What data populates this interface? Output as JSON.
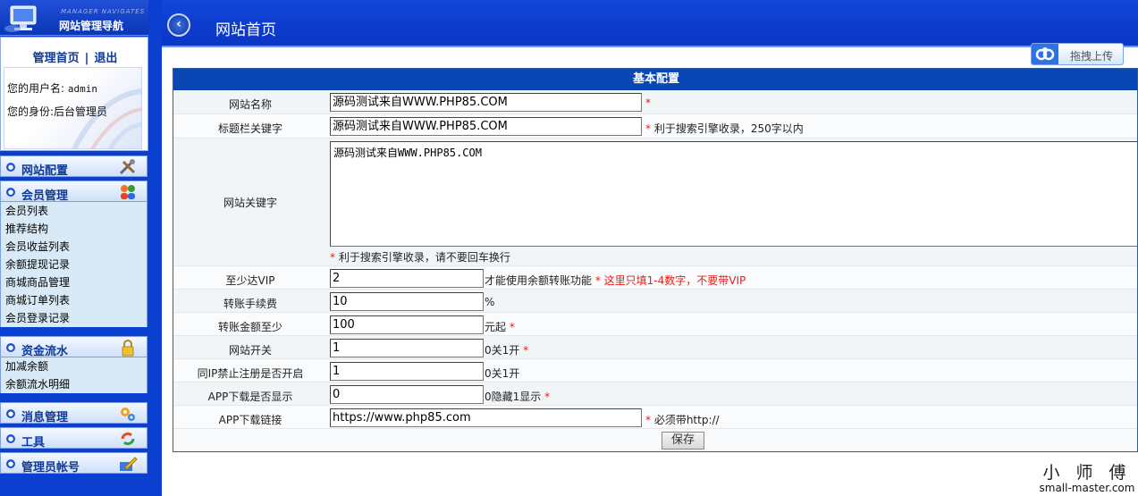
{
  "sidebar": {
    "logo_en": "MANAGER NAVIGATES",
    "logo_cn": "网站管理导航",
    "home_link": "管理首页",
    "separator": "|",
    "logout_link": "退出",
    "username_label": "您的用户名:",
    "username_value": "admin",
    "role_label": "您的身份:",
    "role_value": "后台管理员",
    "menus": [
      {
        "title": "网站配置",
        "icon": "tools-icon",
        "items": []
      },
      {
        "title": "会员管理",
        "icon": "users-icon",
        "items": [
          "会员列表",
          "推荐结构",
          "会员收益列表",
          "余额提现记录",
          "商城商品管理",
          "商城订单列表",
          "会员登录记录"
        ]
      },
      {
        "title": "资金流水",
        "icon": "lock-icon",
        "items": [
          "加减余额",
          "余额流水明细"
        ]
      },
      {
        "title": "消息管理",
        "icon": "gears-icon",
        "items": []
      },
      {
        "title": "工具",
        "icon": "refresh-icon",
        "items": []
      },
      {
        "title": "管理员帐号",
        "icon": "edit-icon",
        "items": []
      }
    ]
  },
  "header": {
    "title": "网站首页",
    "upload_label": "拖拽上传"
  },
  "form": {
    "section_title": "基本配置",
    "site_name": {
      "label": "网站名称",
      "value": "源码测试来自WWW.PHP85.COM",
      "note": "*"
    },
    "title_keywords": {
      "label": "标题栏关键字",
      "value": "源码测试来自WWW.PHP85.COM",
      "note_star": "*",
      "note": "利于搜索引擎收录，250字以内"
    },
    "site_keywords": {
      "label": "网站关键字",
      "value": "源码测试来自WWW.PHP85.COM",
      "note_star": "*",
      "note": "利于搜索引擎收录，请不要回车换行"
    },
    "min_vip": {
      "label": "至少达VIP",
      "value": "2",
      "note": "才能使用余额转账功能",
      "note_star": "*",
      "note_red": "这里只填1-4数字，不要带VIP"
    },
    "transfer_fee": {
      "label": "转账手续费",
      "value": "10",
      "note": "%"
    },
    "min_transfer": {
      "label": "转账金额至少",
      "value": "100",
      "note": "元起",
      "note_star": "*"
    },
    "site_switch": {
      "label": "网站开关",
      "value": "1",
      "note": "0关1开",
      "note_star": "*"
    },
    "same_ip": {
      "label": "同IP禁止注册是否开启",
      "value": "1",
      "note": "0关1开"
    },
    "app_show": {
      "label": "APP下载是否显示",
      "value": "0",
      "note": "0隐藏1显示",
      "note_star": "*"
    },
    "app_link": {
      "label": "APP下载链接",
      "value": "https://www.php85.com",
      "note_star": "*",
      "note": "必须带http://"
    },
    "save_label": "保存"
  },
  "watermark": {
    "cn": "小 师 傅",
    "en": "small-master.com"
  },
  "colors": {
    "sidebar_bg": "#0a3fd0",
    "header_bg": "#0a36c6",
    "section_title_bg": "#0a47b5",
    "required_star": "#e0201a"
  }
}
